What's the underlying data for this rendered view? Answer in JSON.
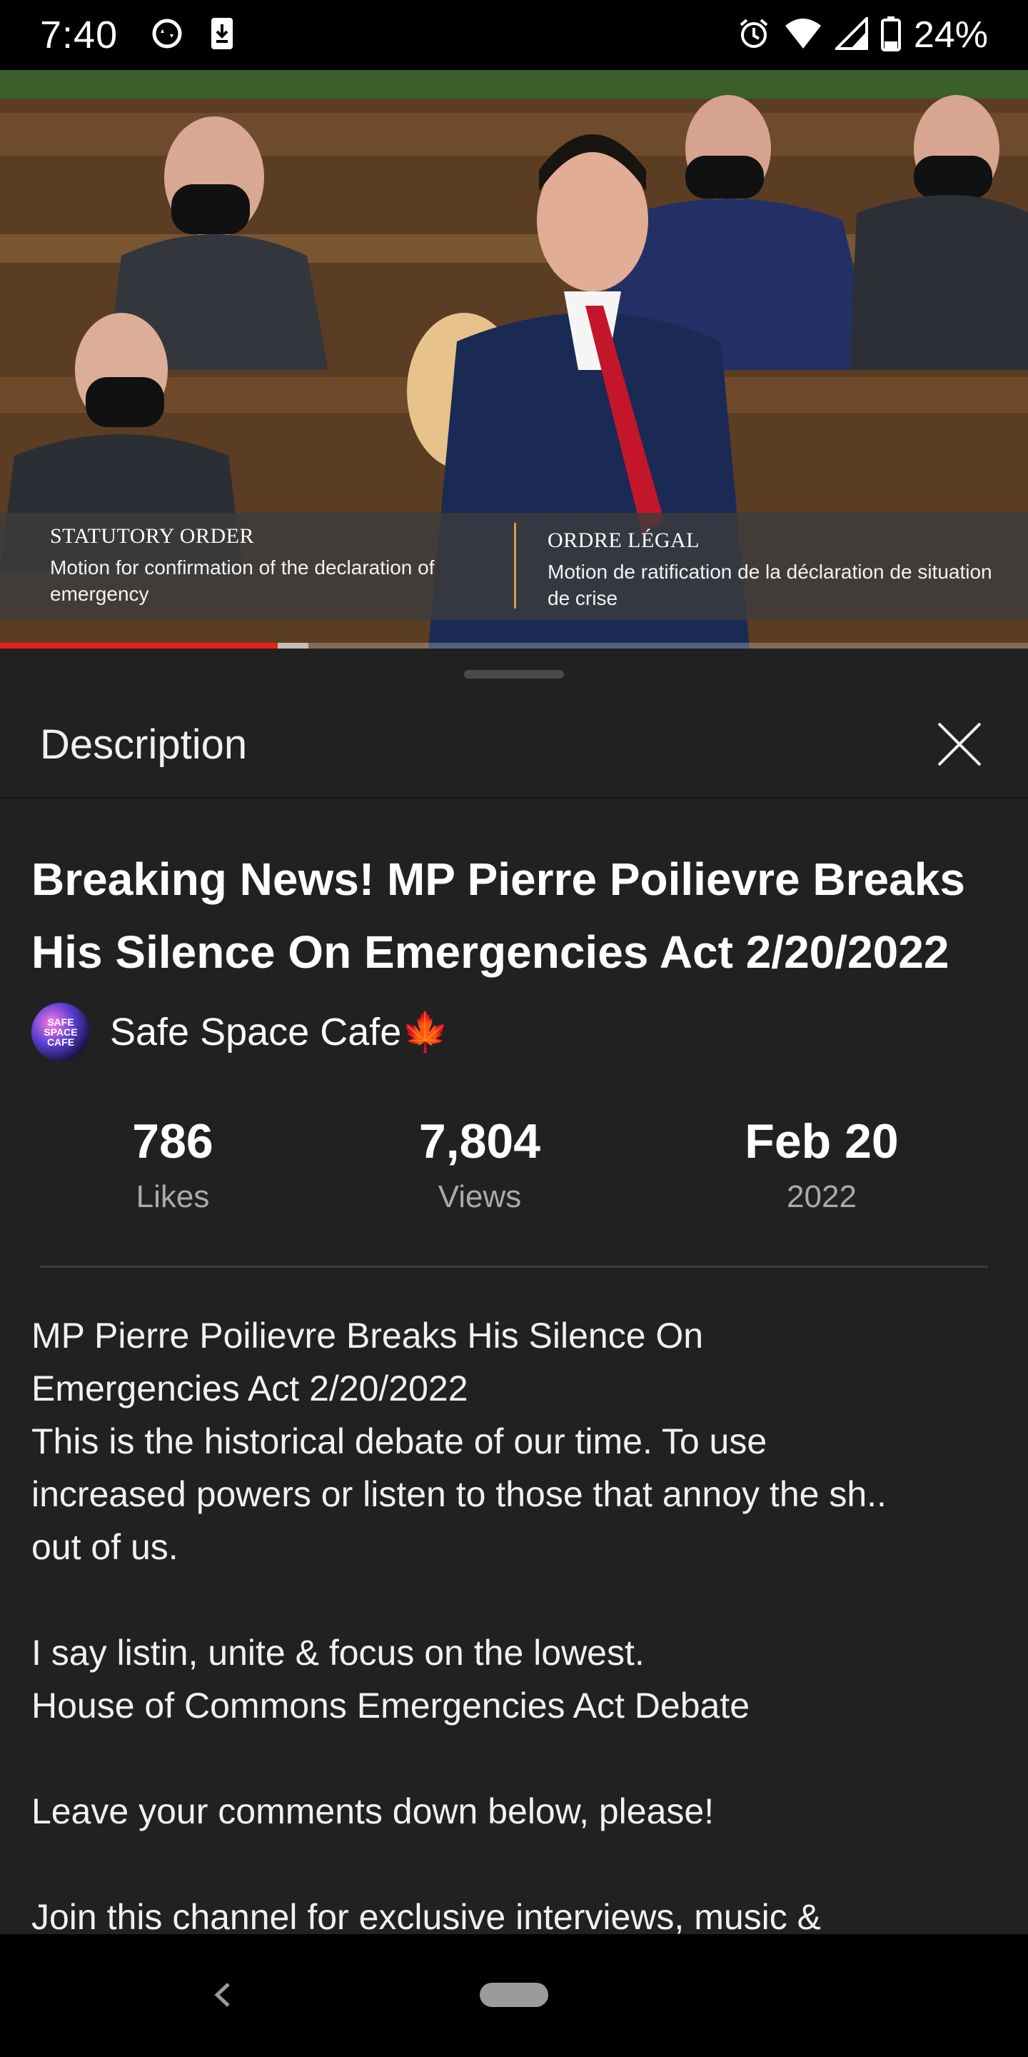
{
  "status_bar": {
    "time": "7:40",
    "battery": "24%",
    "left_icons": [
      "sync-icon",
      "download-icon"
    ],
    "right_icons": [
      "alarm-icon",
      "wifi-icon",
      "signal-icon",
      "battery-icon"
    ]
  },
  "video": {
    "caption_left_heading": "STATUTORY ORDER",
    "caption_left_body": "Motion for confirmation of the declaration of emergency",
    "caption_right_heading": "ORDRE LÉGAL",
    "caption_right_body": "Motion de ratification de la déclaration de situation de crise",
    "progress_played": 0.27,
    "progress_buffered": 0.3,
    "colors": {
      "played": "#e62117",
      "caption_divider": "#c9a33d"
    }
  },
  "sheet": {
    "title": "Description",
    "close_icon": "close-icon",
    "video_title": "Breaking News!  MP Pierre Poilievre Breaks His Silence On Emergencies Act 2/20/2022",
    "channel": {
      "name": "Safe Space Cafe🍁",
      "avatar_text": "SAFE SPACE CAFE"
    },
    "stats": [
      {
        "value": "786",
        "label": "Likes"
      },
      {
        "value": "7,804",
        "label": "Views"
      },
      {
        "value": "Feb 20",
        "label": "2022"
      }
    ],
    "description": "MP Pierre Poilievre Breaks His Silence On\nEmergencies Act 2/20/2022\nThis is the historical debate of our time.  To use\nincreased powers or listen to those that annoy the sh..\nout of us.\n\nI say listin, unite & focus on the lowest.\nHouse of Commons Emergencies Act Debate\n\nLeave your comments down below, please!\n\nJoin this channel for exclusive interviews, music &"
  },
  "nav_bar": {
    "back_icon": "back-icon",
    "home_icon": "home-pill-icon"
  }
}
